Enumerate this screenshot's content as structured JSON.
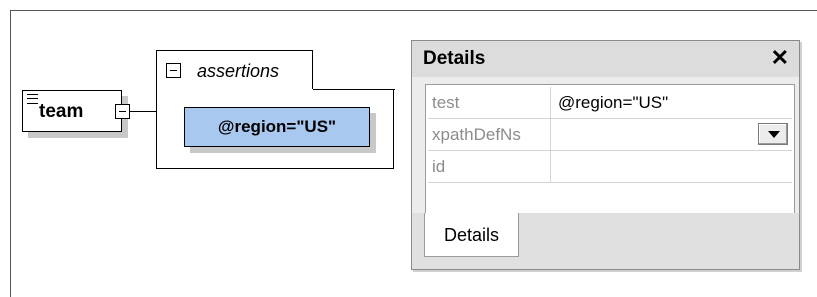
{
  "diagram": {
    "element_label": "team",
    "container_title": "assertions",
    "assertion_label": "@region=\"US\""
  },
  "details_window": {
    "title": "Details",
    "close_glyph": "✕",
    "rows": [
      {
        "name": "test",
        "value": "@region=\"US\""
      },
      {
        "name": "xpathDefNs",
        "value": ""
      },
      {
        "name": "id",
        "value": ""
      }
    ],
    "tab_label": "Details"
  },
  "colors": {
    "assertion_fill": "#a8c8f0",
    "panel_bg": "#ececec"
  }
}
